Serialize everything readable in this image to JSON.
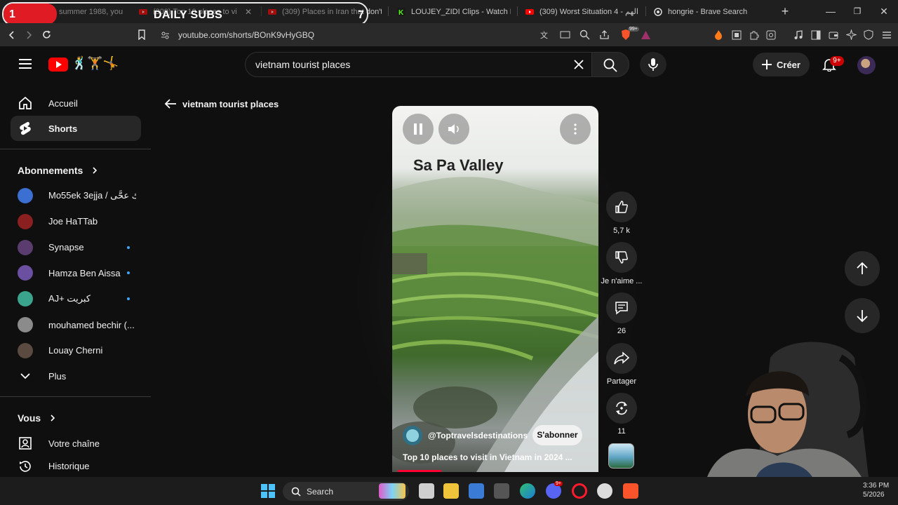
{
  "browser": {
    "tabs": [
      {
        "title": "summer 1988, you"
      },
      {
        "title": "(309) Top 10 places to vi"
      },
      {
        "title": "(309) Places in Iran that don't fe"
      },
      {
        "title": "LOUJEY_ZIDI Clips - Watch Live"
      },
      {
        "title": "(309) Worst Situation 4 - الهم"
      },
      {
        "title": "hongrie - Brave Search"
      }
    ],
    "url": "youtube.com/shorts/BOnK9vHyGBQ",
    "extension_badge": "99+"
  },
  "stream_overlay": {
    "title": "DAILY SUBS",
    "left_number": "1",
    "right_number": "7"
  },
  "header": {
    "logo_emoji": "🕺🏋️🤸",
    "search_value": "vietnam tourist places",
    "create_label": "Créer",
    "notifications_badge": "9+"
  },
  "sidebar": {
    "home": "Accueil",
    "shorts": "Shorts",
    "subscriptions_heading": "Abonnements",
    "subscriptions": [
      {
        "name": "Mo55ek 3ejja / مسيك عحَّى",
        "color": "#3b6fd1",
        "dot": false
      },
      {
        "name": "Joe HaTTab",
        "color": "#8a1f1f",
        "dot": false
      },
      {
        "name": "Synapse",
        "color": "#5a3c6e",
        "dot": true
      },
      {
        "name": "Hamza Ben Aissa",
        "color": "#6b4fa0",
        "dot": true
      },
      {
        "name": "AJ+ كبريت",
        "color": "#3aa58c",
        "dot": true
      },
      {
        "name": "mouhamed bechir (...",
        "color": "#8b8b8b",
        "dot": false
      },
      {
        "name": "Louay Cherni",
        "color": "#5b4a3f",
        "dot": false
      }
    ],
    "more": "Plus",
    "you_heading": "Vous",
    "your_channel": "Votre chaîne",
    "history": "Historique"
  },
  "main": {
    "back_label": "vietnam tourist places",
    "video": {
      "overlay_title": "Sa Pa Valley",
      "channel": "@Toptravelsdestinations",
      "subscribe": "S'abonner",
      "caption": "Top 10 places to visit in Vietnam in 2024 ...",
      "progress": 0.21
    },
    "actions": {
      "likes": "5,7 k",
      "dislike": "Je n'aime ...",
      "comments": "26",
      "share": "Partager",
      "remix": "11"
    }
  },
  "taskbar": {
    "search": "Search",
    "time": "3:36 PM",
    "date": "5/2026",
    "badge": "9+"
  }
}
